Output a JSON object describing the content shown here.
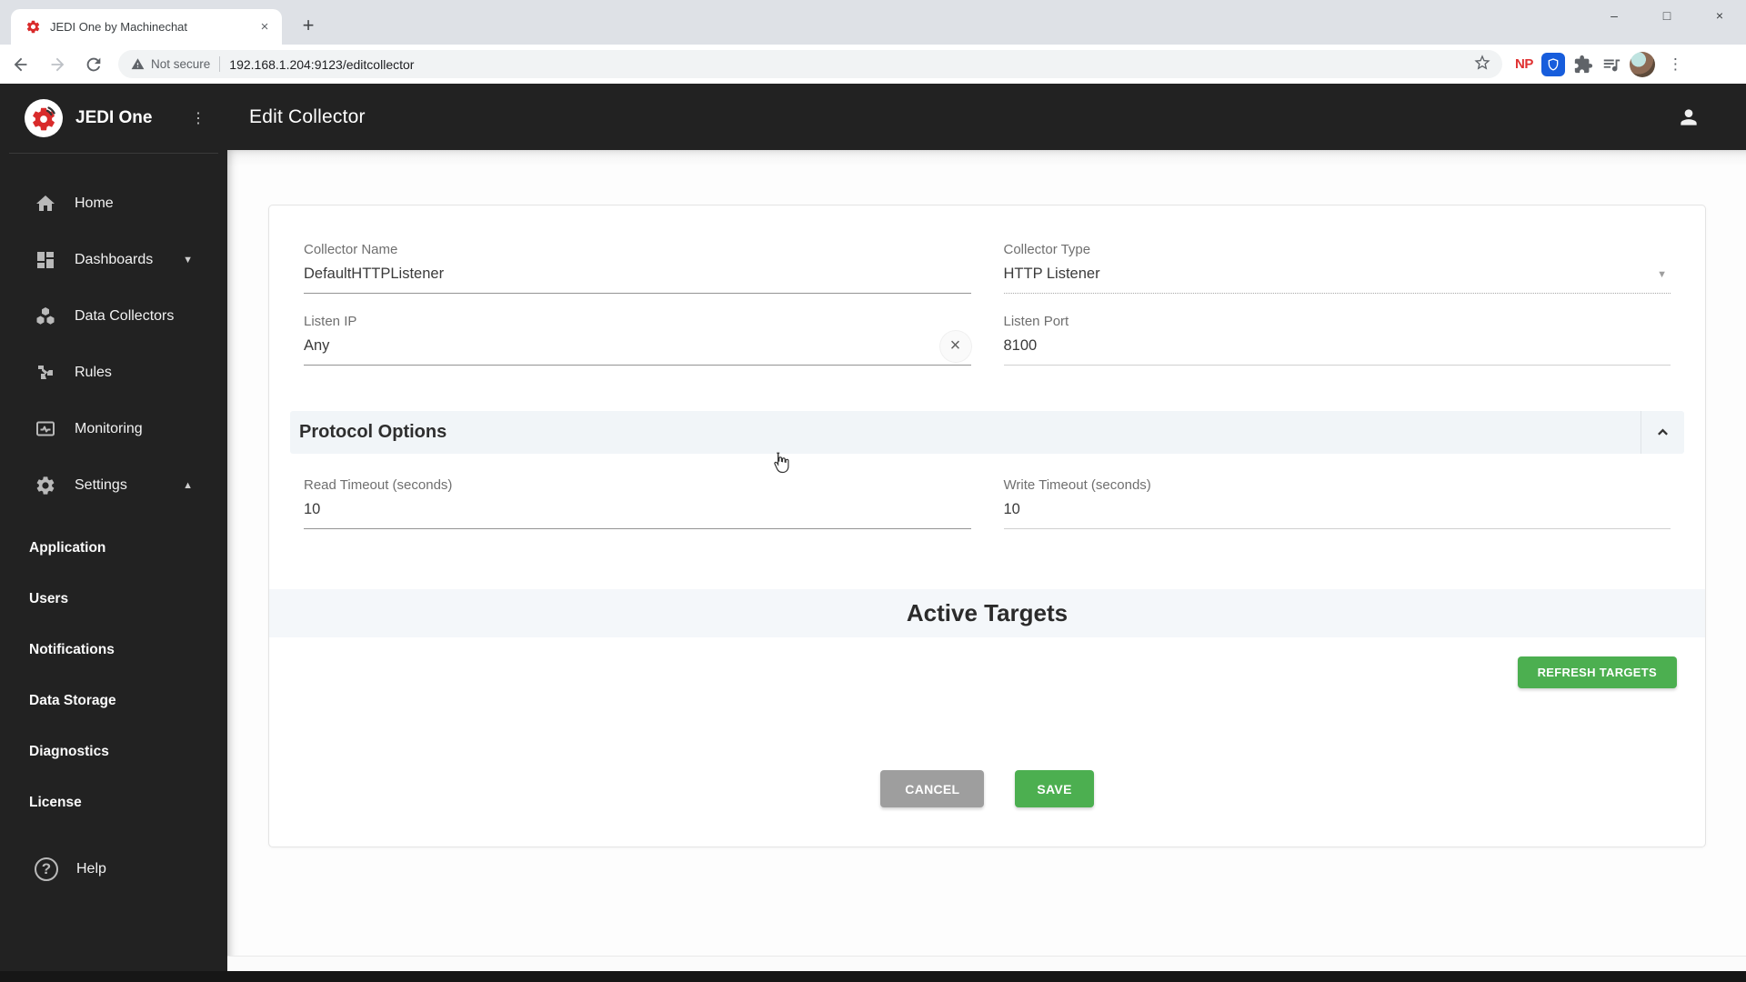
{
  "browser": {
    "tab_title": "JEDI One by Machinechat",
    "security_label": "Not secure",
    "url": "192.168.1.204:9123/editcollector",
    "np_badge": "NP"
  },
  "sidebar": {
    "brand": "JEDI One",
    "items": [
      {
        "label": "Home"
      },
      {
        "label": "Dashboards"
      },
      {
        "label": "Data Collectors"
      },
      {
        "label": "Rules"
      },
      {
        "label": "Monitoring"
      },
      {
        "label": "Settings"
      }
    ],
    "settings_children": [
      "Application",
      "Users",
      "Notifications",
      "Data Storage",
      "Diagnostics",
      "License"
    ],
    "help_label": "Help"
  },
  "header": {
    "title": "Edit Collector"
  },
  "form": {
    "collector_name": {
      "label": "Collector Name",
      "value": "DefaultHTTPListener"
    },
    "collector_type": {
      "label": "Collector Type",
      "value": "HTTP Listener"
    },
    "listen_ip": {
      "label": "Listen IP",
      "value": "Any"
    },
    "listen_port": {
      "label": "Listen Port",
      "value": "8100"
    },
    "protocol_options": {
      "title": "Protocol Options",
      "read_timeout": {
        "label": "Read Timeout (seconds)",
        "value": "10"
      },
      "write_timeout": {
        "label": "Write Timeout (seconds)",
        "value": "10"
      }
    },
    "active_targets": {
      "title": "Active Targets",
      "refresh_label": "REFRESH TARGETS"
    },
    "actions": {
      "cancel": "CANCEL",
      "save": "SAVE"
    }
  },
  "colors": {
    "accent_green": "#4caf50",
    "cancel_gray": "#9e9e9e",
    "brand_red": "#d92b2b",
    "sidebar_bg": "#222222",
    "bitwarden_blue": "#175ddc",
    "np_red": "#e03131"
  }
}
